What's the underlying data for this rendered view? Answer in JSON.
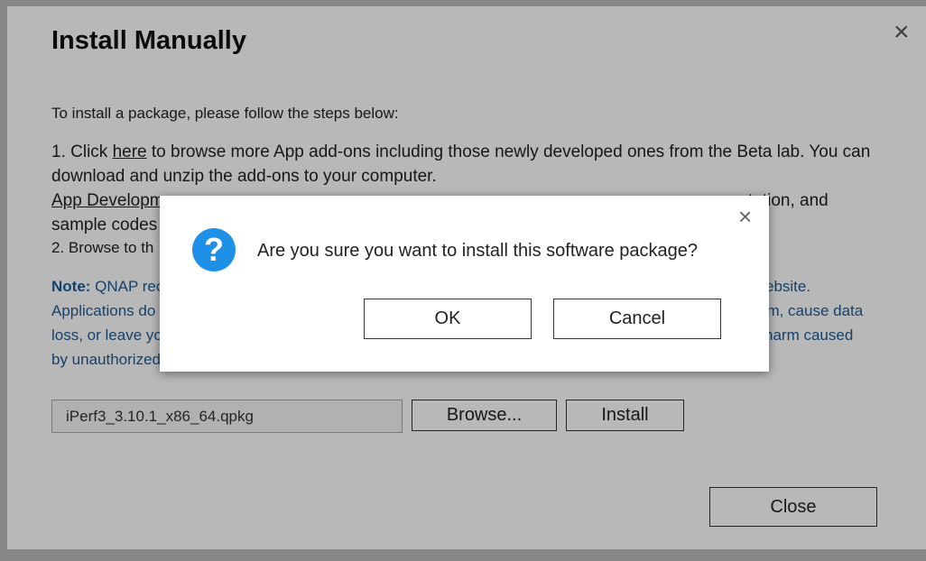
{
  "main_dialog": {
    "title": "Install Manually",
    "close_glyph": "×",
    "intro": "To install a package, please follow the steps below:",
    "step1_prefix": "1. Click ",
    "step1_link": "here",
    "step1_suffix": " to browse more App add-ons including those newly developed ones from the Beta lab. You can download and unzip the add-ons to your computer.",
    "dev_link_visible": "App Developm",
    "dev_right_visible": "tation, and",
    "dev_second_visible": "sample codes",
    "step2_visible": "2. Browse to th",
    "note_label": "Note:",
    "note_line1_visible": " QNAP rec",
    "note_line1_right": "ebsite.",
    "note_line2_visible": "Applications do",
    "note_line2_right": "em, cause data",
    "note_line3_visible": "loss, or leave yo",
    "note_line3_right": "harm caused",
    "note_line4_visible": "by unauthorized",
    "file_value": "iPerf3_3.10.1_x86_64.qpkg",
    "browse_label": "Browse...",
    "install_label": "Install",
    "close_label": "Close"
  },
  "confirm_dialog": {
    "close_glyph": "×",
    "icon": "question-icon",
    "icon_glyph": "?",
    "message": "Are you sure you want to install this software package?",
    "ok_label": "OK",
    "cancel_label": "Cancel"
  },
  "colors": {
    "note_text": "#1f5a93",
    "icon_blue": "#1e90e8",
    "overlay": "rgba(0,0,0,0.28)"
  }
}
